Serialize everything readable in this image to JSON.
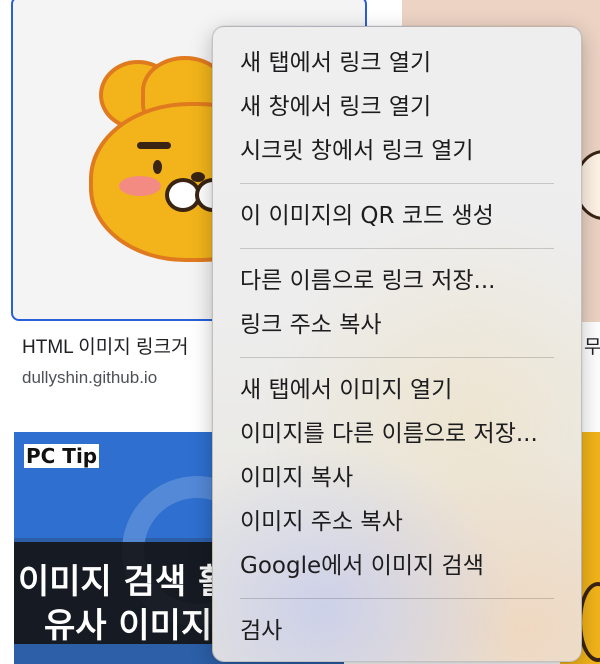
{
  "background": {
    "result_1": {
      "title": "HTML 이미지 링크거",
      "source": "dullyshin.github.io"
    },
    "result_2": {
      "title_fragment": "무료"
    },
    "result_3": {
      "badge": "PC Tip",
      "line1": "이미지 검색 활",
      "line2": "유사 이미지"
    }
  },
  "context_menu": {
    "groups": [
      [
        {
          "label": "새 탭에서 링크 열기"
        },
        {
          "label": "새 창에서 링크 열기"
        },
        {
          "label": "시크릿 창에서 링크 열기"
        }
      ],
      [
        {
          "label": "이 이미지의 QR 코드 생성"
        }
      ],
      [
        {
          "label": "다른 이름으로 링크 저장..."
        },
        {
          "label": "링크 주소 복사"
        }
      ],
      [
        {
          "label": "새 탭에서 이미지 열기"
        },
        {
          "label": "이미지를 다른 이름으로 저장..."
        },
        {
          "label": "이미지 복사"
        },
        {
          "label": "이미지 주소 복사"
        },
        {
          "label": "Google에서 이미지 검색"
        }
      ],
      [
        {
          "label": "검사"
        }
      ]
    ]
  },
  "colors": {
    "focus_border": "#2b5fd9",
    "menu_text": "#1d1d1f"
  }
}
